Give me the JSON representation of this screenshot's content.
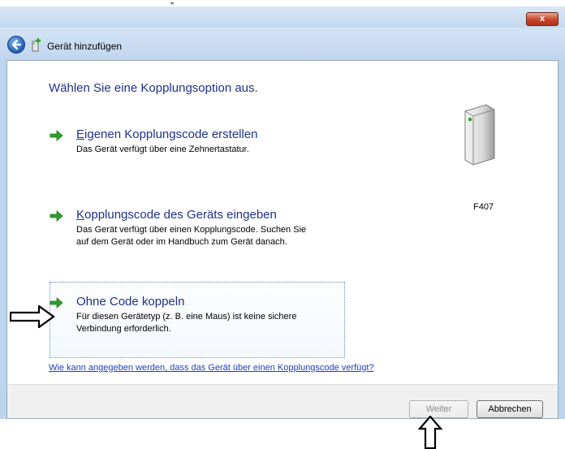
{
  "outer_caption": "„",
  "window": {
    "close_label": "x",
    "wizard_title": "Gerät hinzufügen"
  },
  "content": {
    "heading": "Wählen Sie eine Kopplungsoption aus.",
    "options": [
      {
        "title": "Eigenen Kopplungscode erstellen",
        "accesskey": "E",
        "desc": "Das Gerät verfügt über eine Zehnertastatur."
      },
      {
        "title": "Kopplungscode des Geräts eingeben",
        "accesskey": "K",
        "desc": "Das Gerät verfügt über einen Kopplungscode. Suchen Sie auf dem Gerät oder im Handbuch zum Gerät danach."
      },
      {
        "title": "Ohne Code koppeln",
        "accesskey": "",
        "desc": "Für diesen Gerätetyp (z. B. eine Maus) ist keine sichere Verbindung erforderlich."
      }
    ],
    "device_label": "F407",
    "help_link": "Wie kann angegeben werden, dass das Gerät über einen Kopplungscode verfügt?"
  },
  "footer": {
    "next_label": "Weiter",
    "cancel_label": "Abbrechen"
  },
  "colors": {
    "link_blue": "#1e3287",
    "arrow_green": "#2aa02a",
    "title_bar": "#c3d8ee"
  },
  "icons": {
    "back": "back-arrow-icon",
    "wizard": "device-add-icon",
    "option_arrow": "green-arrow-icon",
    "device": "computer-device-icon"
  }
}
